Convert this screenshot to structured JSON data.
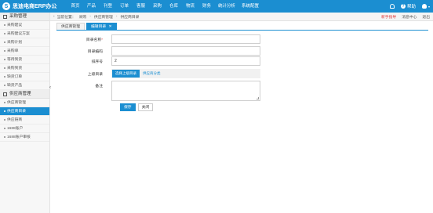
{
  "app": {
    "logo_mark": "S",
    "logo_text": "思迪电商ERP办公"
  },
  "nav": [
    {
      "label": "首页"
    },
    {
      "label": "产品"
    },
    {
      "label": "刊登"
    },
    {
      "label": "订单"
    },
    {
      "label": "客服"
    },
    {
      "label": "采购"
    },
    {
      "label": "仓库"
    },
    {
      "label": "物流"
    },
    {
      "label": "财务"
    },
    {
      "label": "统计分析"
    },
    {
      "label": "系统配置"
    }
  ],
  "topright": {
    "help_label": "帮助",
    "user_caret": "▾"
  },
  "sidebar": {
    "group1": "采购管理",
    "group1_items": [
      {
        "label": "采购建议"
      },
      {
        "label": "采购建议方案"
      },
      {
        "label": "采购计划"
      },
      {
        "label": "采购单"
      },
      {
        "label": "等待到货"
      },
      {
        "label": "采购到货"
      },
      {
        "label": "缺货订单"
      },
      {
        "label": "缺货产品"
      }
    ],
    "group2": "供应商管理",
    "group2_items": [
      {
        "label": "供应商管理"
      },
      {
        "label": "供应商目录"
      },
      {
        "label": "供应链商"
      },
      {
        "label": "1688账户"
      },
      {
        "label": "1688账户审核"
      }
    ],
    "collapse": "‹"
  },
  "breadcrumb": {
    "arrow": "›",
    "items": [
      "当前位置：",
      "采购",
      "供应商管理",
      "供应商目录"
    ],
    "right": {
      "red_link": "新手指导",
      "center": "消息中心",
      "logout": "退出"
    }
  },
  "tabs": [
    {
      "label": "供应商管理"
    },
    {
      "label": "编辑目录",
      "close": "✕"
    }
  ],
  "form": {
    "name_label": "目录名称",
    "name_req": "*",
    "name_value": "",
    "code_label": "目录编码",
    "code_value": "",
    "sort_label": "排序号",
    "sort_value": "2",
    "parent_label": "上级目录",
    "parent_btn": "选择上级目录",
    "parent_value": "供应商分类",
    "remark_label": "备注",
    "save": "保存",
    "close": "关闭"
  },
  "colors": {
    "primary": "#1b8ed1",
    "danger": "#e03c3c"
  }
}
